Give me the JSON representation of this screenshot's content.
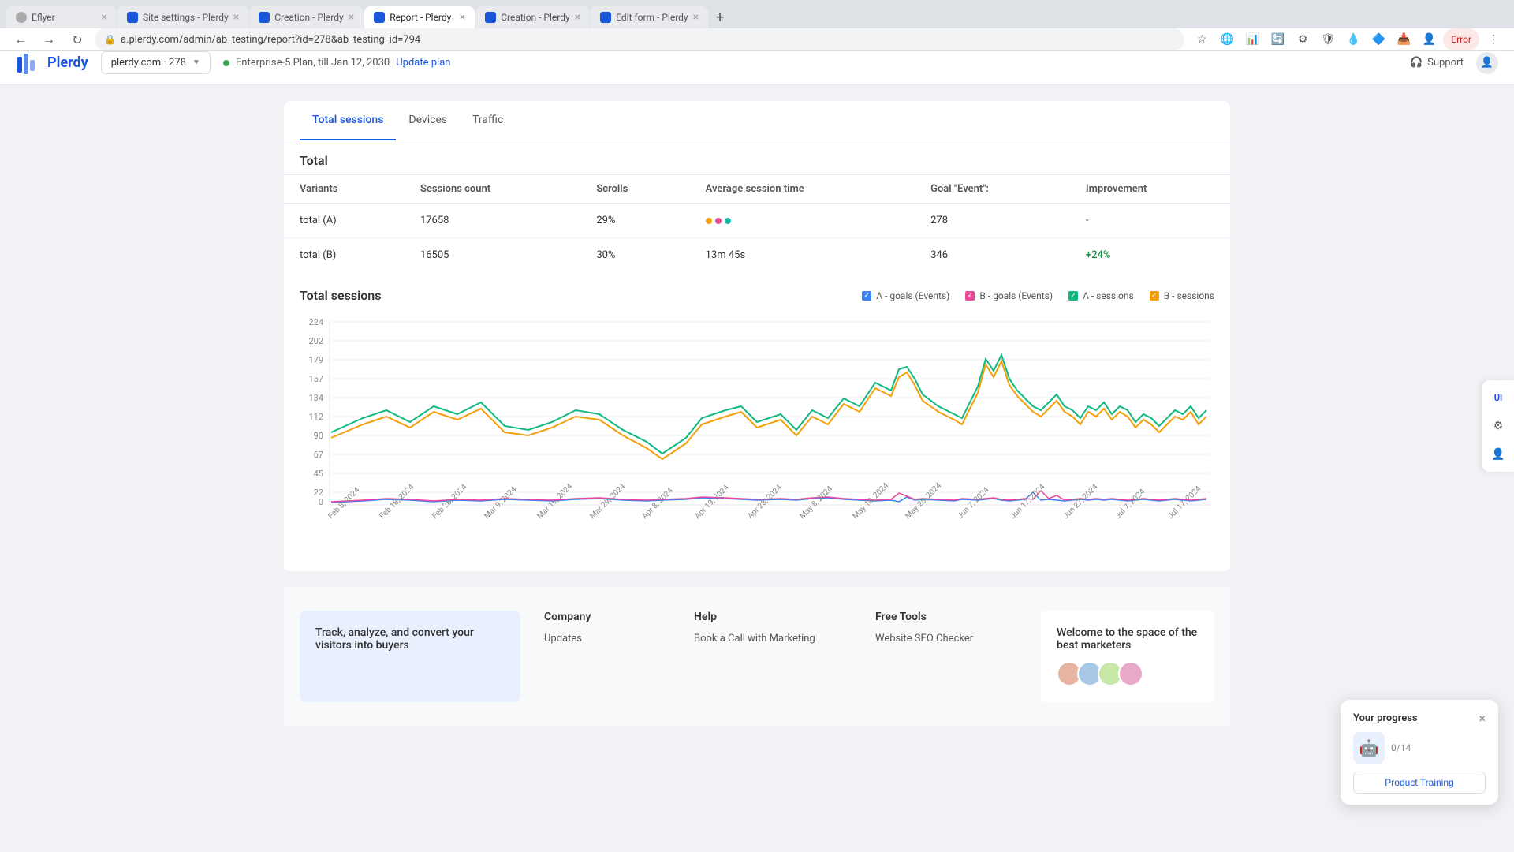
{
  "browser": {
    "tabs": [
      {
        "id": "eflyer",
        "icon_color": "#888",
        "label": "Eflyer",
        "active": false,
        "has_close": true
      },
      {
        "id": "site-settings",
        "icon_color": "#1a56db",
        "label": "Site settings - Plerdy",
        "active": false,
        "has_close": true
      },
      {
        "id": "creation-1",
        "icon_color": "#1a56db",
        "label": "Creation - Plerdy",
        "active": false,
        "has_close": true
      },
      {
        "id": "report",
        "icon_color": "#1a56db",
        "label": "Report - Plerdy",
        "active": true,
        "has_close": true
      },
      {
        "id": "creation-2",
        "icon_color": "#1a56db",
        "label": "Creation - Plerdy",
        "active": false,
        "has_close": true
      },
      {
        "id": "edit-form",
        "icon_color": "#1a56db",
        "label": "Edit form - Plerdy",
        "active": false,
        "has_close": true
      }
    ],
    "url": "a.plerdy.com/admin/ab_testing/report?id=278&ab_testing_id=794",
    "error_label": "Error"
  },
  "header": {
    "logo_text": "Plerdy",
    "site_selector": "plerdy.com · 278",
    "plan_text": "Enterprise-5 Plan, till Jan 12, 2030",
    "update_plan_label": "Update plan",
    "support_label": "Support"
  },
  "tabs": {
    "items": [
      {
        "id": "total-sessions",
        "label": "Total sessions",
        "active": true
      },
      {
        "id": "devices",
        "label": "Devices",
        "active": false
      },
      {
        "id": "traffic",
        "label": "Traffic",
        "active": false
      }
    ]
  },
  "table": {
    "section_title": "Total",
    "headers": [
      "Variants",
      "Sessions count",
      "Scrolls",
      "Average session time",
      "Goal \"Event\":",
      "Improvement"
    ],
    "rows": [
      {
        "variant": "total (A)",
        "sessions": "17658",
        "scrolls": "29%",
        "avg_time": "",
        "goal": "278",
        "improvement": "-",
        "has_dots": true
      },
      {
        "variant": "total (B)",
        "sessions": "16505",
        "scrolls": "30%",
        "avg_time": "13m 45s",
        "goal": "346",
        "improvement": "+24%",
        "has_dots": false
      }
    ]
  },
  "chart": {
    "title": "Total sessions",
    "legend": [
      {
        "label": "A - goals (Events)",
        "color": "#3b82f6",
        "type": "check"
      },
      {
        "label": "B - goals (Events)",
        "color": "#ec4899",
        "type": "check"
      },
      {
        "label": "A - sessions",
        "color": "#10b981",
        "type": "check"
      },
      {
        "label": "B - sessions",
        "color": "#f59e0b",
        "type": "check"
      }
    ],
    "y_labels": [
      "224",
      "202",
      "179",
      "157",
      "134",
      "112",
      "90",
      "67",
      "45",
      "22",
      "0"
    ],
    "x_labels": [
      "Feb 8, 2024",
      "Feb 18, 2024",
      "Feb 28, 2024",
      "Mar 9, 2024",
      "Mar 19, 2024",
      "Mar 29, 2024",
      "Apr 8, 2024",
      "Apr 19, 2024",
      "Apr 28, 2024",
      "May 8, 2024",
      "May 18, 2024",
      "May 28, 2024",
      "Jun 7, 2024",
      "Jun 17, 2024",
      "Jun 27, 2024",
      "Jul 7, 2024",
      "Jul 17, 2024"
    ]
  },
  "footer": {
    "tagline": "Track, analyze, and convert your visitors into buyers",
    "columns": {
      "company": {
        "title": "Company",
        "links": [
          "Updates"
        ]
      },
      "help": {
        "title": "Help",
        "links": [
          "Book a Call with Marketing"
        ]
      },
      "free_tools": {
        "title": "Free Tools",
        "links": [
          "Website SEO Checker"
        ]
      },
      "welcome": {
        "title": "Welcome to the space of the best marketers"
      }
    }
  },
  "progress_widget": {
    "title": "Your progress",
    "score": "0/14",
    "button_label": "Product Training",
    "close_label": "×"
  },
  "right_sidebar": {
    "tools": [
      {
        "id": "ui",
        "label": "UI"
      },
      {
        "id": "gear",
        "label": "⚙"
      },
      {
        "id": "person",
        "label": "👤"
      }
    ]
  }
}
